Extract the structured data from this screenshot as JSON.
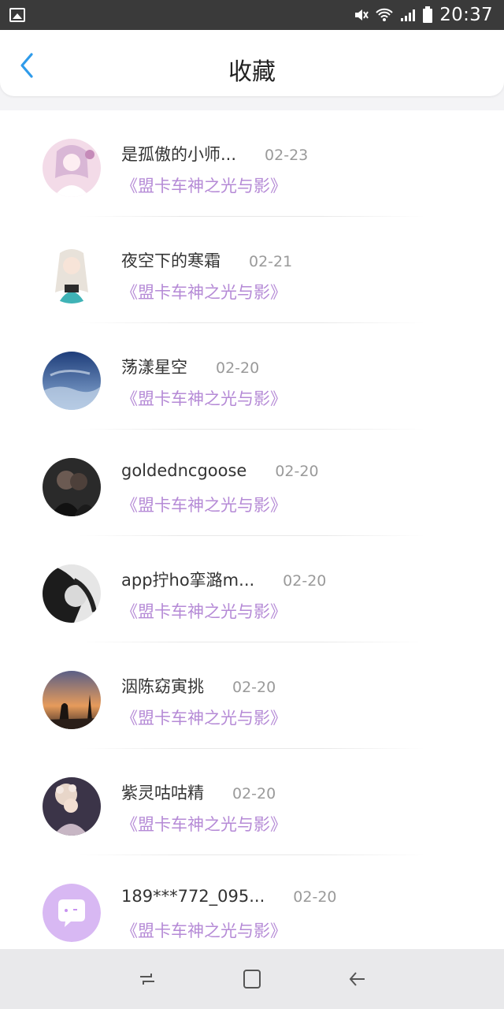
{
  "status_bar": {
    "time": "20:37",
    "icons": [
      "gallery-icon",
      "mute-icon",
      "wifi-icon",
      "signal-icon",
      "battery-icon"
    ]
  },
  "header": {
    "title": "收藏",
    "back_icon": "chevron-left-icon"
  },
  "items": [
    {
      "username": "是孤傲的小师...",
      "date": "02-23",
      "book": "《盟卡车神之光与影》",
      "avatar": "anime-girl-pink"
    },
    {
      "username": "夜空下的寒霜",
      "date": "02-21",
      "book": "《盟卡车神之光与影》",
      "avatar": "anime-girl-white"
    },
    {
      "username": "荡漾星空",
      "date": "02-20",
      "book": "《盟卡车神之光与影》",
      "avatar": "sky-clouds"
    },
    {
      "username": "goldedncgoose",
      "date": "02-20",
      "book": "《盟卡车神之光与影》",
      "avatar": "couple-dark"
    },
    {
      "username": "app拧ho挛潞m...",
      "date": "02-20",
      "book": "《盟卡车神之光与影》",
      "avatar": "girl-bw"
    },
    {
      "username": "洇陈窈寅挑",
      "date": "02-20",
      "book": "《盟卡车神之光与影》",
      "avatar": "sunset-couple"
    },
    {
      "username": "紫灵咕咕精",
      "date": "02-20",
      "book": "《盟卡车神之光与影》",
      "avatar": "flower-girl"
    },
    {
      "username": "189***772_095...",
      "date": "02-20",
      "book": "《盟卡车神之光与影》",
      "avatar": "default-chat"
    }
  ],
  "nav": {
    "recent_icon": "recent-apps-icon",
    "home_icon": "home-icon",
    "back_icon": "back-arrow-icon"
  },
  "colors": {
    "accent": "#2f9bea",
    "book": "#b58ad6",
    "date": "#9a9a9a"
  }
}
